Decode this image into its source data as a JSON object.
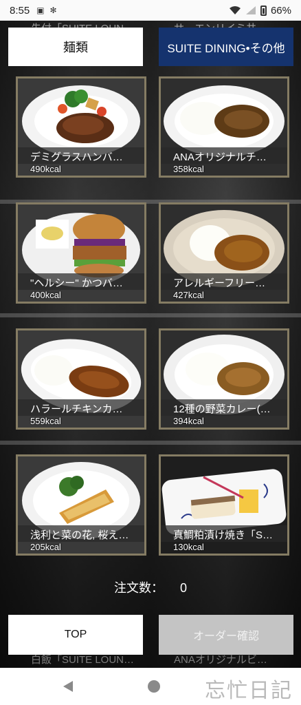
{
  "status_bar": {
    "time": "8:55",
    "battery": "66%",
    "icons": [
      "screenshot-icon",
      "fan-icon",
      "wifi-icon",
      "cellular-icon",
      "battery-icon"
    ]
  },
  "peek_items": {
    "left": "先付「SUITE LOUN",
    "right": "サ　エンリイミ井"
  },
  "categories": {
    "left": "麺類",
    "right": "SUITE DINING•その他"
  },
  "menu_items": [
    {
      "name": "デミグラスハンバ…",
      "kcal": "490kcal"
    },
    {
      "name": "ANAオリジナルチ…",
      "kcal": "358kcal"
    },
    {
      "name": "\"ヘルシー\" かつバ…",
      "kcal": "400kcal"
    },
    {
      "name": "アレルギーフリー…",
      "kcal": "427kcal"
    },
    {
      "name": "ハラールチキンカ…",
      "kcal": "559kcal"
    },
    {
      "name": "12種の野菜カレー(…",
      "kcal": "394kcal"
    },
    {
      "name": "浅利と菜の花, 桜え…",
      "kcal": "205kcal"
    },
    {
      "name": "真鯛粕漬け焼き「S…",
      "kcal": "130kcal"
    }
  ],
  "order": {
    "label": "注文数：",
    "count": "0"
  },
  "buttons": {
    "top": "TOP",
    "order_confirm": "オーダー確認"
  },
  "faded_items": {
    "left": "白飯「SUITE LOUN…",
    "right": "ANAオリジナルビ…"
  },
  "nav": {
    "watermark": "忘忙日記"
  }
}
